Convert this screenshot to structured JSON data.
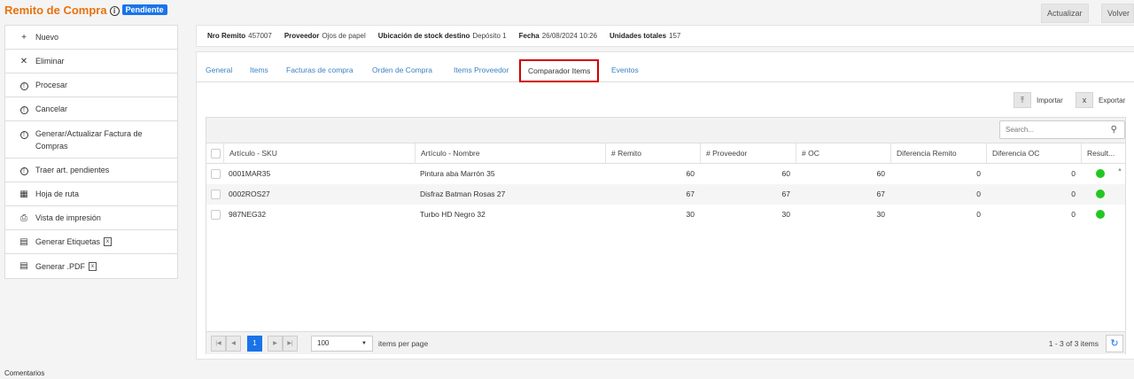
{
  "header": {
    "title": "Remito de Compra",
    "status_badge": "Pendiente",
    "buttons": {
      "refresh": "Actualizar",
      "back": "Volver"
    }
  },
  "sidebar": {
    "items": [
      {
        "icon": "plus-icon",
        "label": "Nuevo"
      },
      {
        "icon": "x-icon",
        "label": "Eliminar"
      },
      {
        "icon": "info-icon",
        "label": "Procesar"
      },
      {
        "icon": "info-icon",
        "label": "Cancelar"
      },
      {
        "icon": "info-icon",
        "label": "Generar/Actualizar Factura de Compras"
      },
      {
        "icon": "info-icon",
        "label": "Traer art. pendientes"
      },
      {
        "icon": "calendar-icon",
        "label": "Hoja de ruta"
      },
      {
        "icon": "printer-icon",
        "label": "Vista de impresión"
      },
      {
        "icon": "document-icon",
        "label": "Generar Etiquetas"
      },
      {
        "icon": "document-icon",
        "label": "Generar .PDF"
      }
    ],
    "comments_label": "Comentarios"
  },
  "summary": {
    "nro_remito_label": "Nro Remito",
    "nro_remito": "457007",
    "proveedor_label": "Proveedor",
    "proveedor": "Ojos de papel",
    "ubicacion_label": "Ubicación de stock destino",
    "ubicacion": "Depósito 1",
    "fecha_label": "Fecha",
    "fecha": "26/08/2024 10:26",
    "unidades_label": "Unidades totales",
    "unidades": "157"
  },
  "tabs": [
    "General",
    "Items",
    "Facturas de compra",
    "Orden de Compra",
    "Items Proveedor",
    "Comparador Items",
    "Eventos"
  ],
  "active_tab": "Comparador Items",
  "actions": {
    "import": "Importar",
    "export": "Exportar"
  },
  "grid": {
    "search_placeholder": "Search...",
    "columns": [
      "Artículo - SKU",
      "Artículo - Nombre",
      "# Remito",
      "# Proveedor",
      "# OC",
      "Diferencia Remito",
      "Diferencia OC",
      "Result..."
    ],
    "rows": [
      {
        "sku": "0001MAR35",
        "nombre": "Pintura aba Marrón 35",
        "remito": "60",
        "proveedor": "60",
        "oc": "60",
        "dif_remito": "0",
        "dif_oc": "0"
      },
      {
        "sku": "0002ROS27",
        "nombre": "Disfraz Batman Rosas 27",
        "remito": "67",
        "proveedor": "67",
        "oc": "67",
        "dif_remito": "0",
        "dif_oc": "0"
      },
      {
        "sku": "987NEG32",
        "nombre": "Turbo HD Negro 32",
        "remito": "30",
        "proveedor": "30",
        "oc": "30",
        "dif_remito": "0",
        "dif_oc": "0"
      }
    ],
    "result_color": "#22c722"
  },
  "pager": {
    "current_page": "1",
    "page_size": "100",
    "items_per_page_label": "items per page",
    "range_text": "1 - 3 of 3 items"
  },
  "colors": {
    "accent": "#1a73e8",
    "title": "#e8720c",
    "tab_link": "#3b82c4",
    "highlight": "#d00000"
  }
}
